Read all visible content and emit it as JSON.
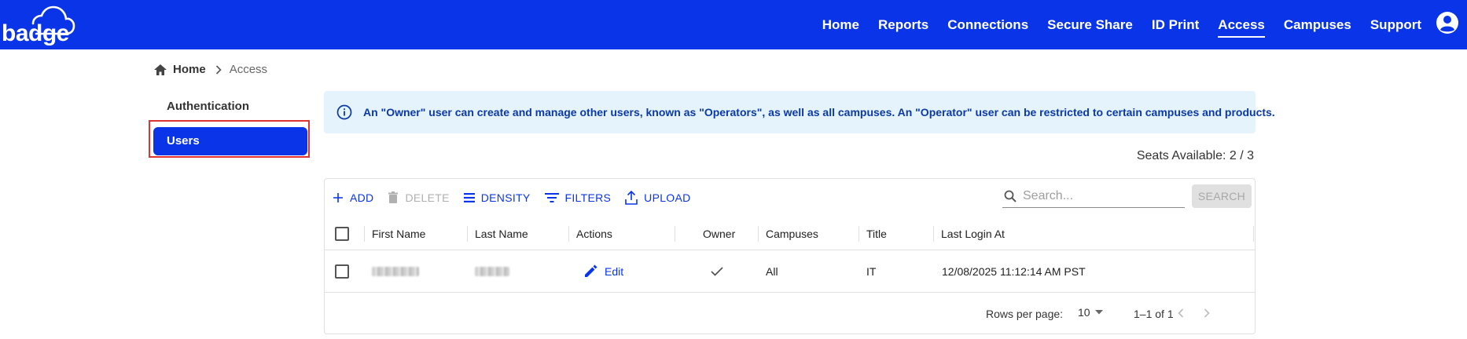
{
  "header": {
    "logo_text": "badge",
    "nav": [
      {
        "label": "Home",
        "name": "nav-home",
        "active": false
      },
      {
        "label": "Reports",
        "name": "nav-reports",
        "active": false
      },
      {
        "label": "Connections",
        "name": "nav-connections",
        "active": false
      },
      {
        "label": "Secure Share",
        "name": "nav-secure-share",
        "active": false
      },
      {
        "label": "ID Print",
        "name": "nav-id-print",
        "active": false
      },
      {
        "label": "Access",
        "name": "nav-access",
        "active": true
      },
      {
        "label": "Campuses",
        "name": "nav-campuses",
        "active": false
      },
      {
        "label": "Support",
        "name": "nav-support",
        "active": false
      }
    ],
    "icons": {
      "user": "account-circle-icon"
    },
    "brand_color": "#0a34e8"
  },
  "breadcrumb": {
    "home": "Home",
    "current": "Access"
  },
  "sidebar": {
    "items": [
      {
        "label": "Authentication",
        "active": false
      },
      {
        "label": "Users",
        "active": true
      }
    ],
    "highlight_color": "#e33232"
  },
  "info_banner": {
    "text": "An \"Owner\" user can create and manage other users, known as \"Operators\", as well as all campuses. An \"Operator\" user can be restricted to certain campuses and products."
  },
  "seats": {
    "label": "Seats Available: 2 / 3"
  },
  "toolbar": {
    "add": "ADD",
    "delete": "DELETE",
    "density": "DENSITY",
    "filters": "FILTERS",
    "upload": "UPLOAD",
    "search_placeholder": "Search...",
    "search_button": "SEARCH"
  },
  "table": {
    "columns": [
      "First Name",
      "Last Name",
      "Actions",
      "Owner",
      "Campuses",
      "Title",
      "Last Login At"
    ],
    "rows": [
      {
        "first_name": "",
        "last_name": "",
        "action": "Edit",
        "owner": true,
        "campuses": "All",
        "title": "IT",
        "last_login": "12/08/2025 11:12:14 AM PST"
      }
    ]
  },
  "pagination": {
    "rows_per_page_label": "Rows per page:",
    "rows_per_page": "10",
    "range": "1–1 of 1"
  }
}
